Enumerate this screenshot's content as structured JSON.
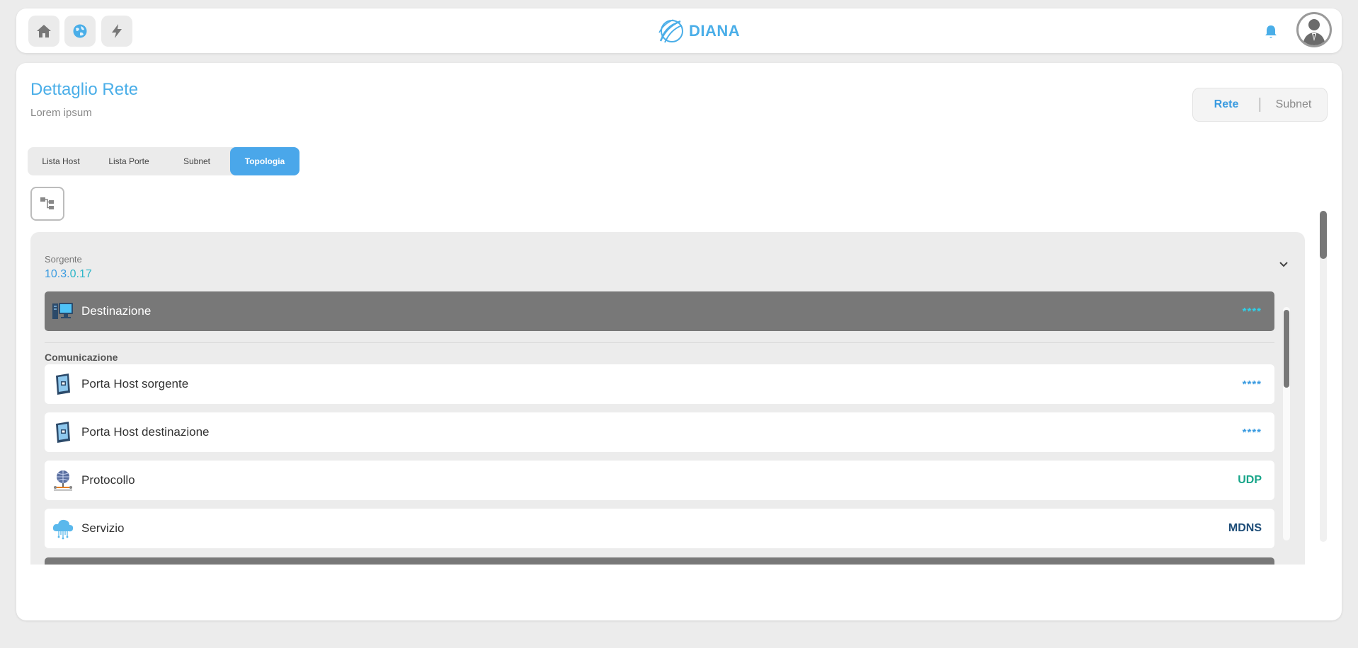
{
  "topbar": {
    "brand": "DIANA",
    "nav": [
      {
        "icon": "home-icon"
      },
      {
        "icon": "globe-icon"
      },
      {
        "icon": "lightning-icon"
      }
    ],
    "notification_icon": "bell-icon",
    "avatar_icon": "user-avatar-icon"
  },
  "page": {
    "title": "Dettaglio Rete",
    "subtitle": "Lorem ipsum"
  },
  "view_toggle": {
    "options": [
      "Rete",
      "Subnet"
    ],
    "selected": "Rete"
  },
  "tabs": [
    {
      "label": "Lista Host",
      "active": false
    },
    {
      "label": "Lista Porte",
      "active": false
    },
    {
      "label": "Subnet",
      "active": false
    },
    {
      "label": "Topologia",
      "active": true
    }
  ],
  "tree_button_icon": "tree-structure-icon",
  "source": {
    "label": "Sorgente",
    "ip_part1": "10.3.",
    "ip_part2": "0.17"
  },
  "destination": {
    "label": "Destinazione",
    "value": "****"
  },
  "communication": {
    "label": "Comunicazione",
    "rows": [
      {
        "label": "Porta Host sorgente",
        "value": "****"
      },
      {
        "label": "Porta Host destinazione",
        "value": "****"
      },
      {
        "label": "Protocollo",
        "value": "UDP"
      },
      {
        "label": "Servizio",
        "value": "MDNS"
      }
    ]
  },
  "colors": {
    "accent": "#4aaee8",
    "tab_active": "#4aa7ea",
    "protocol_value": "#17a589",
    "service_value": "#1e4d78",
    "destination_bar": "#787878"
  }
}
